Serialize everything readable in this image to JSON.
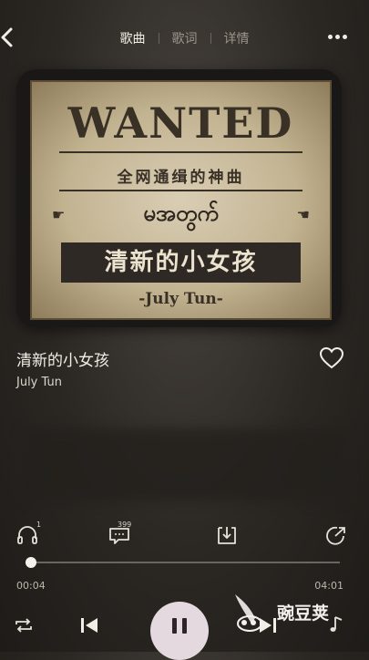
{
  "header": {
    "tabs": [
      {
        "label": "歌曲",
        "active": true
      },
      {
        "label": "歌词",
        "active": false
      },
      {
        "label": "详情",
        "active": false
      }
    ]
  },
  "cover": {
    "wanted": "WANTED",
    "subtitle": "全网通缉的神曲",
    "burmese": "မအတွက်",
    "song_cn": "清新的小女孩",
    "artist_en": "-July Tun-"
  },
  "track": {
    "title": "清新的小女孩",
    "artist": "July Tun"
  },
  "actions": {
    "listen_badge": "1",
    "comment_count": "399"
  },
  "playback": {
    "elapsed": "00:04",
    "duration": "04:01",
    "progress": 0.017
  },
  "watermark": {
    "text": "豌豆荚"
  },
  "colors": {
    "background": "#2b2723",
    "pause_button": "#e3d9df",
    "text_primary": "#f2eee6"
  }
}
